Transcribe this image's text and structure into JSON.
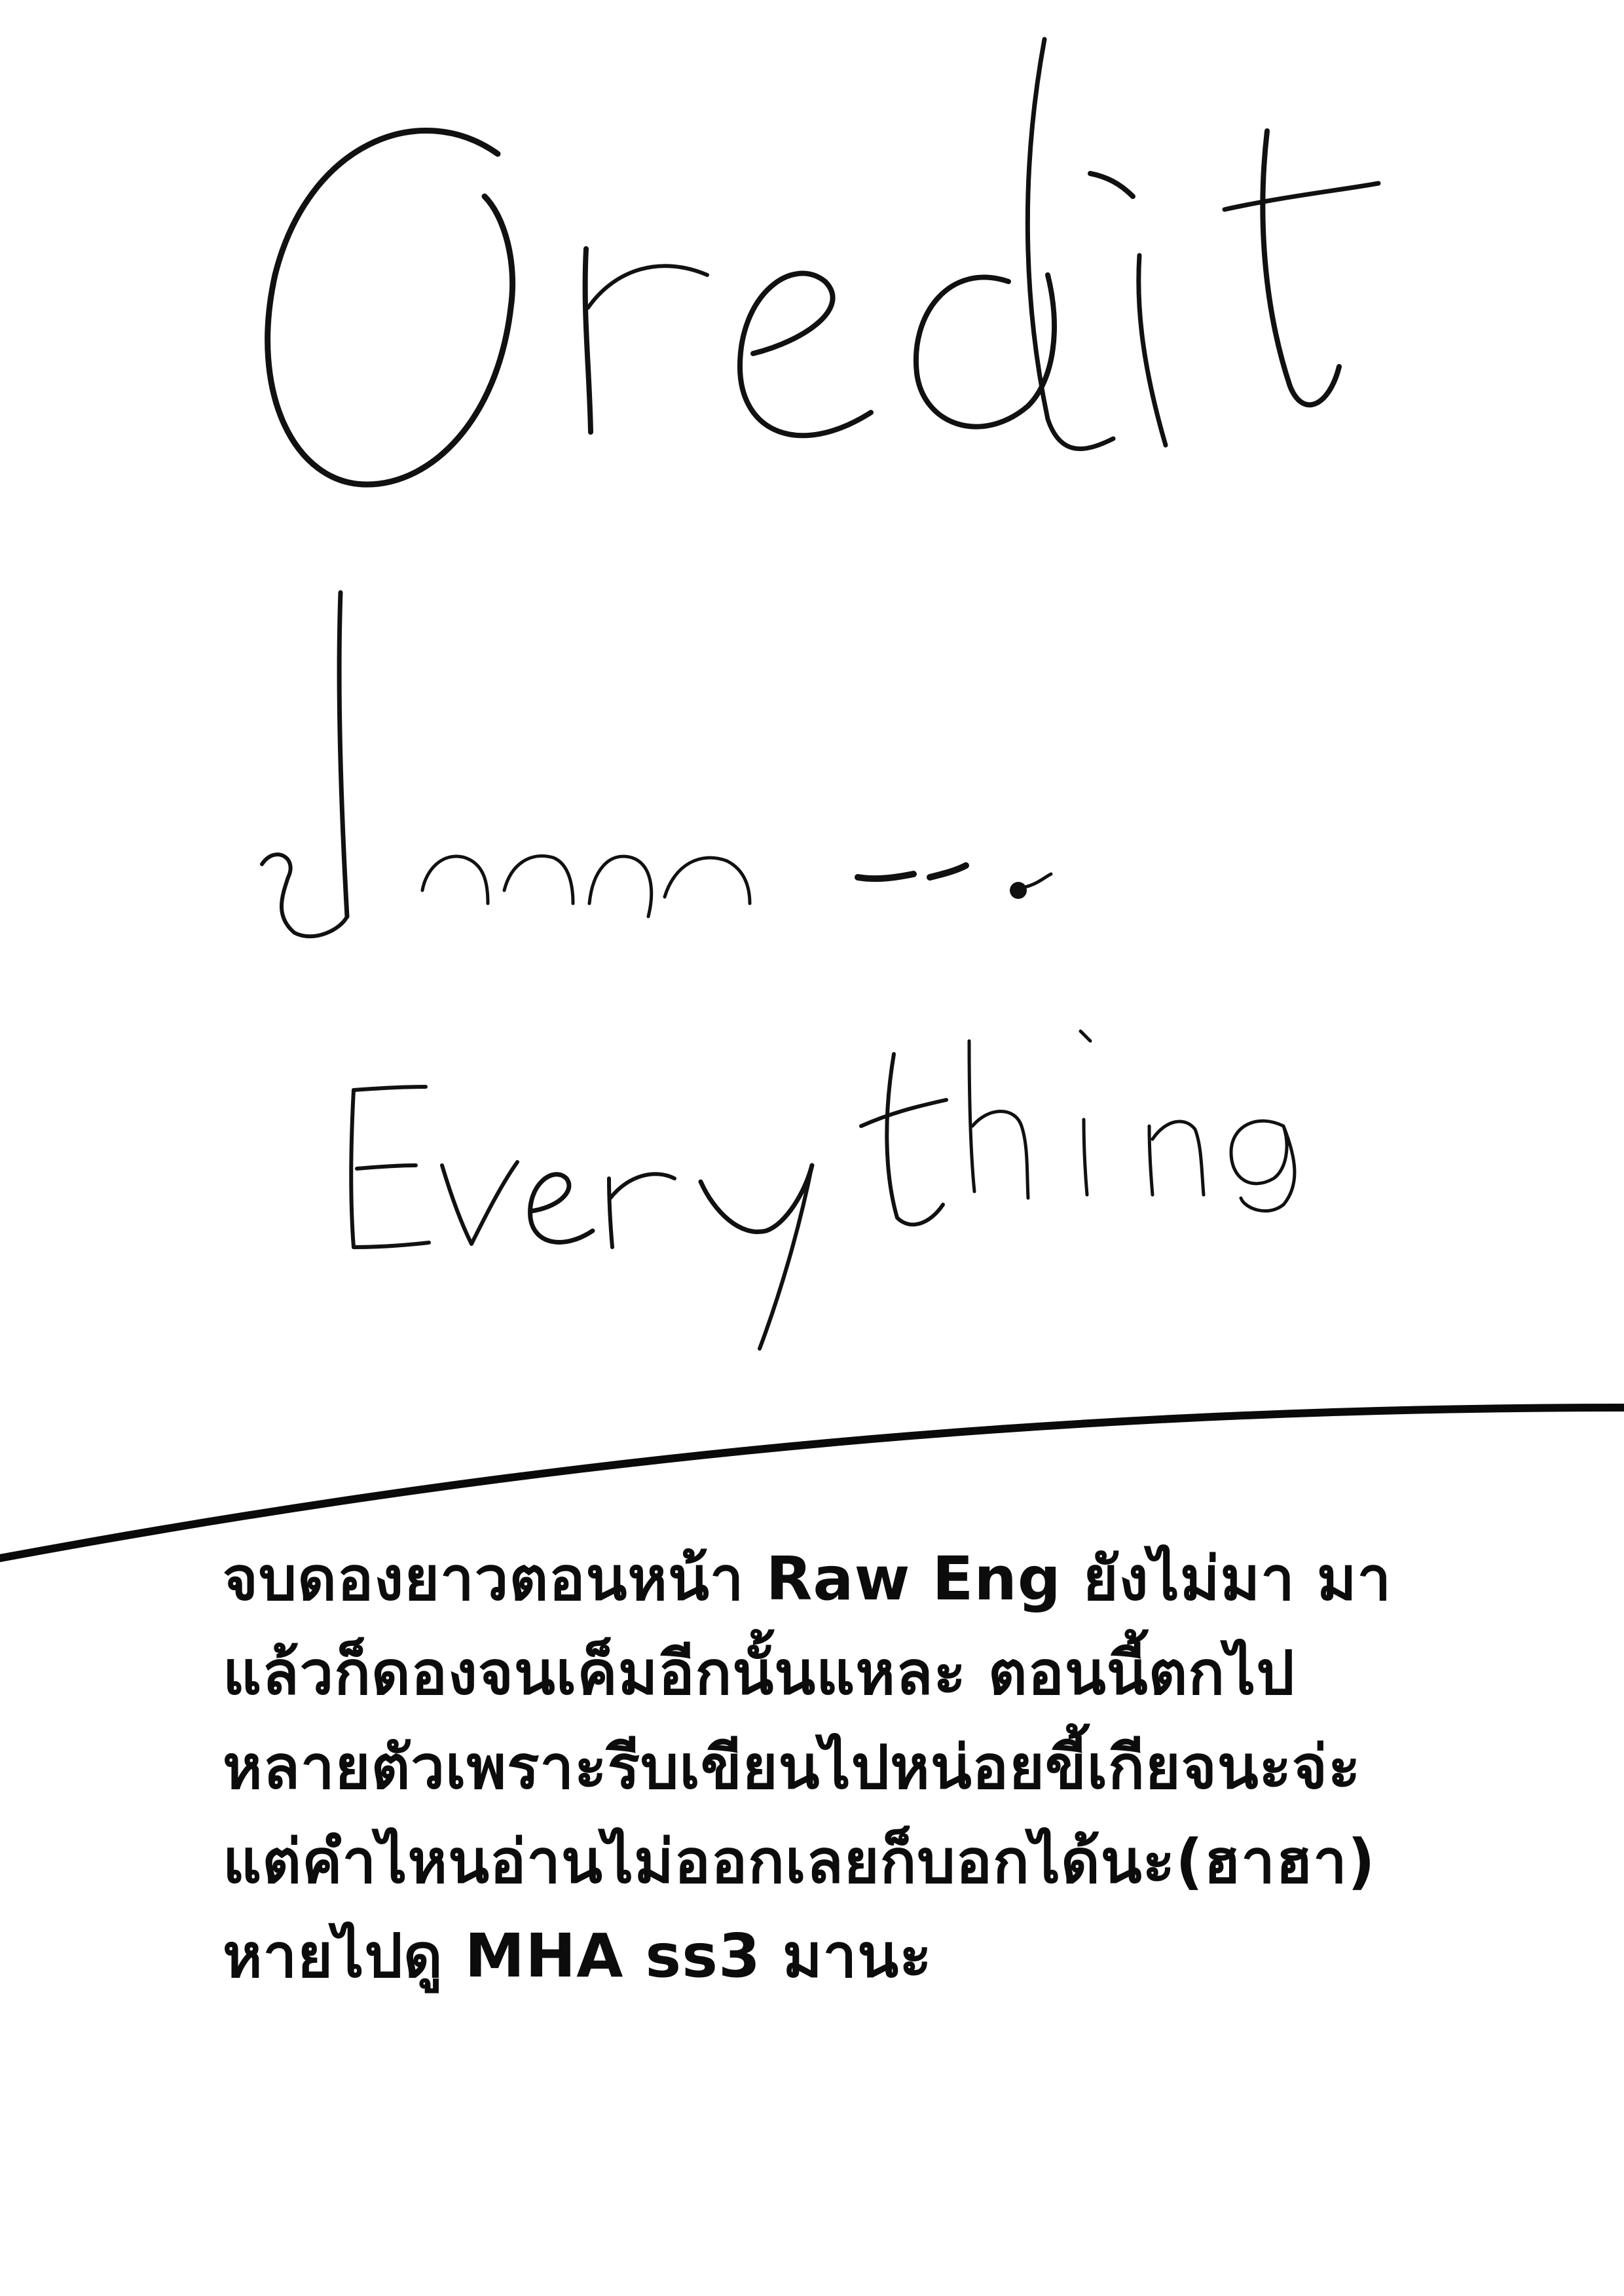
{
  "handwritten": {
    "title": "Credit",
    "thai_scribble": "ปากกา",
    "everything": "Everything"
  },
  "notes": {
    "lines": [
      "จบดองยาวตอนหน้า Raw Eng ยังไม่มา มา",
      "แล้วก็ดองจนเค็มอีกนั้นแหละ ตอนนี้ตกไป",
      "หลายตัวเพราะรีบเขียนไปหน่อยขี้เกียจนะจ่ะ",
      "แต่คำไหนอ่านไม่ออกเลยก็บอกได้นะ(ฮาฮา)",
      "หายไปดู MHA ss3 มานะ"
    ]
  },
  "colors": {
    "ink": "#111111",
    "background": "#ffffff"
  }
}
